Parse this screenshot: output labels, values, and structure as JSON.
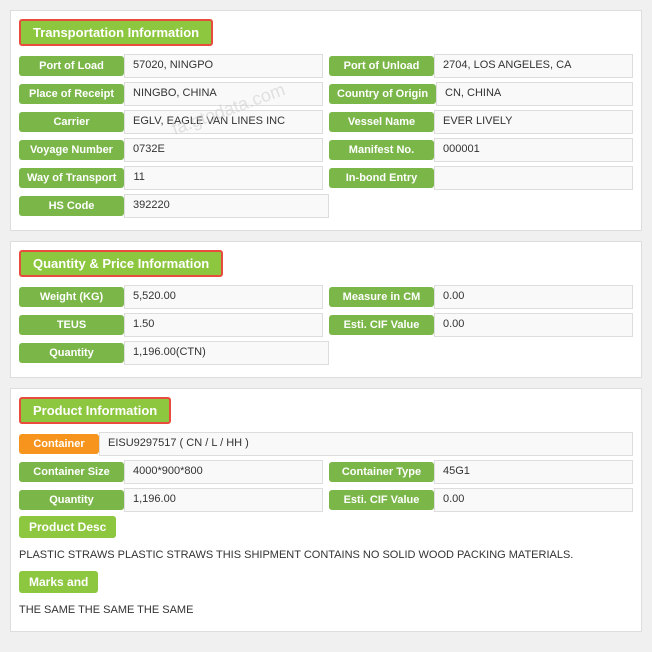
{
  "transportation": {
    "header": "Transportation Information",
    "fields": {
      "port_of_load_label": "Port of Load",
      "port_of_load_value": "57020, NINGPO",
      "port_of_unload_label": "Port of Unload",
      "port_of_unload_value": "2704, LOS ANGELES, CA",
      "place_of_receipt_label": "Place of Receipt",
      "place_of_receipt_value": "NINGBO, CHINA",
      "country_of_origin_label": "Country of Origin",
      "country_of_origin_value": "CN, CHINA",
      "carrier_label": "Carrier",
      "carrier_value": "EGLV, EAGLE VAN LINES INC",
      "vessel_name_label": "Vessel Name",
      "vessel_name_value": "EVER LIVELY",
      "voyage_number_label": "Voyage Number",
      "voyage_number_value": "0732E",
      "manifest_no_label": "Manifest No.",
      "manifest_no_value": "000001",
      "way_of_transport_label": "Way of Transport",
      "way_of_transport_value": "11",
      "in_bond_entry_label": "In-bond Entry",
      "in_bond_entry_value": "",
      "hs_code_label": "HS Code",
      "hs_code_value": "392220"
    }
  },
  "quantity": {
    "header": "Quantity & Price Information",
    "fields": {
      "weight_label": "Weight (KG)",
      "weight_value": "5,520.00",
      "measure_label": "Measure in CM",
      "measure_value": "0.00",
      "teus_label": "TEUS",
      "teus_value": "1.50",
      "esti_cif_label": "Esti. CIF Value",
      "esti_cif_value": "0.00",
      "quantity_label": "Quantity",
      "quantity_value": "1,196.00(CTN)"
    }
  },
  "product": {
    "header": "Product Information",
    "container_label": "Container",
    "container_value": "EISU9297517 ( CN / L / HH )",
    "container_size_label": "Container Size",
    "container_size_value": "4000*900*800",
    "container_type_label": "Container Type",
    "container_type_value": "45G1",
    "quantity_label": "Quantity",
    "quantity_value": "1,196.00",
    "esti_cif_label": "Esti. CIF Value",
    "esti_cif_value": "0.00",
    "product_desc_label": "Product Desc",
    "product_desc_text": "PLASTIC STRAWS PLASTIC STRAWS THIS SHIPMENT CONTAINS NO SOLID WOOD PACKING MATERIALS.",
    "marks_label": "Marks and",
    "marks_text": "THE SAME THE SAME THE SAME"
  },
  "watermark": "fa.gtodata.com"
}
